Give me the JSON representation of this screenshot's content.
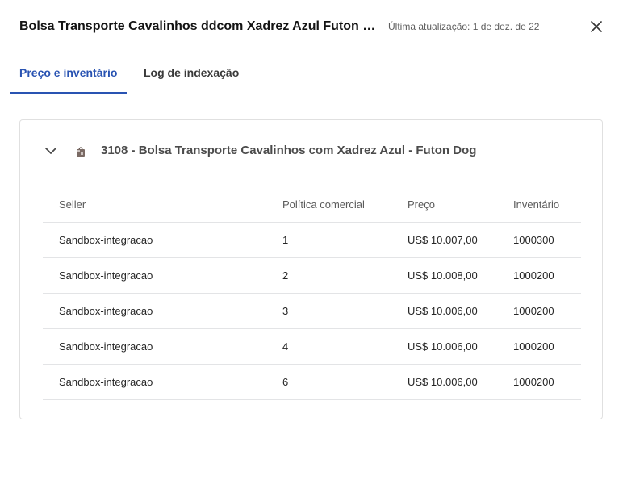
{
  "header": {
    "title": "Bolsa Transporte Cavalinhos ddcom Xadrez Azul Futon Dog....",
    "updated": "Última atualização: 1 de dez. de 22",
    "close_icon": "close-icon"
  },
  "tabs": [
    {
      "label": "Preço e inventário",
      "active": true
    },
    {
      "label": "Log de indexação",
      "active": false
    }
  ],
  "product": {
    "title": "3108 - Bolsa Transporte Cavalinhos com Xadrez Azul - Futon Dog",
    "expand_icon": "chevron-down-icon",
    "thumbnail_icon": "product-thumbnail-icon"
  },
  "table": {
    "headers": [
      "Seller",
      "Política comercial",
      "Preço",
      "Inventário"
    ],
    "rows": [
      [
        "Sandbox-integracao",
        "1",
        "US$ 10.007,00",
        "1000300"
      ],
      [
        "Sandbox-integracao",
        "2",
        "US$ 10.008,00",
        "1000200"
      ],
      [
        "Sandbox-integracao",
        "3",
        "US$ 10.006,00",
        "1000200"
      ],
      [
        "Sandbox-integracao",
        "4",
        "US$ 10.006,00",
        "1000200"
      ],
      [
        "Sandbox-integracao",
        "6",
        "US$ 10.006,00",
        "1000200"
      ]
    ]
  }
}
